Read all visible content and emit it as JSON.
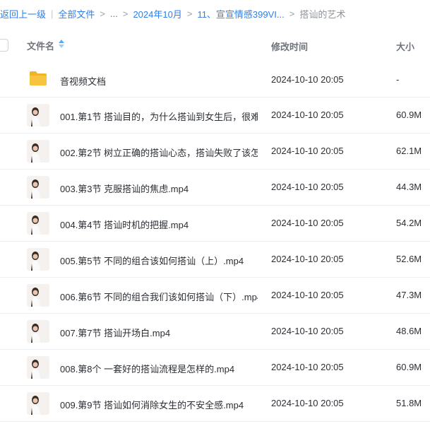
{
  "breadcrumb": {
    "back": "返回上一级",
    "sep": "|",
    "all_files": "全部文件",
    "arrow": ">",
    "ellipsis": "...",
    "folder1": "2024年10月",
    "folder2": "11、宣宣情感399VI...",
    "current": "搭讪的艺术"
  },
  "header": {
    "name": "文件名",
    "modified": "修改时间",
    "size": "大小"
  },
  "colors": {
    "accent": "#2f7fe8",
    "folder": "#f7c440"
  },
  "rows": [
    {
      "icon": "folder-icon",
      "name": "音视频文档",
      "time": "2024-10-10 20:05",
      "size": "-"
    },
    {
      "icon": "video-thumbnail",
      "name": "001.第1节 搭讪目的，为什么搭讪到女生后，很难...",
      "time": "2024-10-10 20:05",
      "size": "60.9M"
    },
    {
      "icon": "video-thumbnail",
      "name": "002.第2节 树立正确的搭讪心态，搭讪失败了该怎...",
      "time": "2024-10-10 20:05",
      "size": "62.1M"
    },
    {
      "icon": "video-thumbnail",
      "name": "003.第3节 克服搭讪的焦虑.mp4",
      "time": "2024-10-10 20:05",
      "size": "44.3M"
    },
    {
      "icon": "video-thumbnail",
      "name": "004.第4节 搭讪时机的把握.mp4",
      "time": "2024-10-10 20:05",
      "size": "54.2M"
    },
    {
      "icon": "video-thumbnail",
      "name": "005.第5节 不同的组合该如何搭讪（上）.mp4",
      "time": "2024-10-10 20:05",
      "size": "52.6M"
    },
    {
      "icon": "video-thumbnail",
      "name": "006.第6节 不同的组合我们该如何搭讪（下）.mp4",
      "time": "2024-10-10 20:05",
      "size": "47.3M"
    },
    {
      "icon": "video-thumbnail",
      "name": "007.第7节 搭讪开场白.mp4",
      "time": "2024-10-10 20:05",
      "size": "48.6M"
    },
    {
      "icon": "video-thumbnail",
      "name": "008.第8个 一套好的搭讪流程是怎样的.mp4",
      "time": "2024-10-10 20:05",
      "size": "60.9M"
    },
    {
      "icon": "video-thumbnail",
      "name": "009.第9节 搭讪如何消除女生的不安全感.mp4",
      "time": "2024-10-10 20:05",
      "size": "51.8M"
    }
  ]
}
